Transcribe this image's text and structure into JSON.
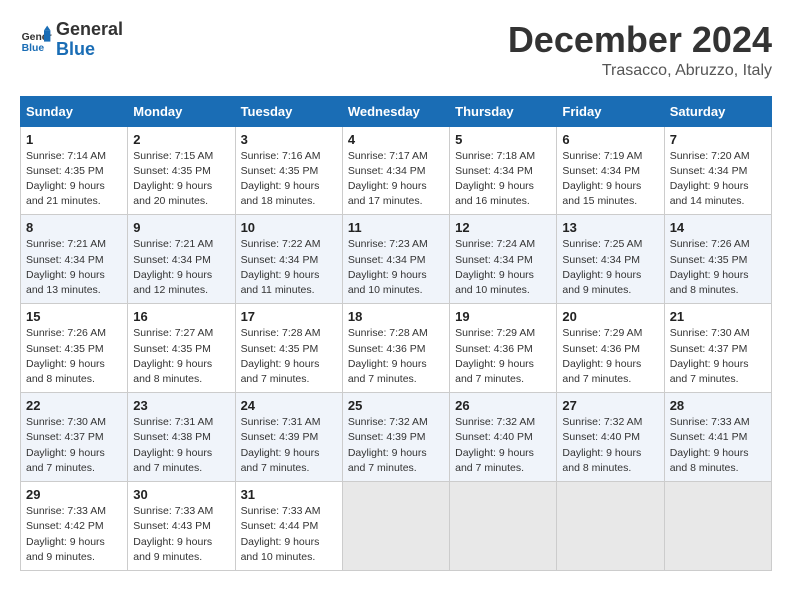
{
  "header": {
    "logo_line1": "General",
    "logo_line2": "Blue",
    "month": "December 2024",
    "location": "Trasacco, Abruzzo, Italy"
  },
  "weekdays": [
    "Sunday",
    "Monday",
    "Tuesday",
    "Wednesday",
    "Thursday",
    "Friday",
    "Saturday"
  ],
  "weeks": [
    [
      {
        "day": "1",
        "sunrise": "Sunrise: 7:14 AM",
        "sunset": "Sunset: 4:35 PM",
        "daylight": "Daylight: 9 hours and 21 minutes."
      },
      {
        "day": "2",
        "sunrise": "Sunrise: 7:15 AM",
        "sunset": "Sunset: 4:35 PM",
        "daylight": "Daylight: 9 hours and 20 minutes."
      },
      {
        "day": "3",
        "sunrise": "Sunrise: 7:16 AM",
        "sunset": "Sunset: 4:35 PM",
        "daylight": "Daylight: 9 hours and 18 minutes."
      },
      {
        "day": "4",
        "sunrise": "Sunrise: 7:17 AM",
        "sunset": "Sunset: 4:34 PM",
        "daylight": "Daylight: 9 hours and 17 minutes."
      },
      {
        "day": "5",
        "sunrise": "Sunrise: 7:18 AM",
        "sunset": "Sunset: 4:34 PM",
        "daylight": "Daylight: 9 hours and 16 minutes."
      },
      {
        "day": "6",
        "sunrise": "Sunrise: 7:19 AM",
        "sunset": "Sunset: 4:34 PM",
        "daylight": "Daylight: 9 hours and 15 minutes."
      },
      {
        "day": "7",
        "sunrise": "Sunrise: 7:20 AM",
        "sunset": "Sunset: 4:34 PM",
        "daylight": "Daylight: 9 hours and 14 minutes."
      }
    ],
    [
      {
        "day": "8",
        "sunrise": "Sunrise: 7:21 AM",
        "sunset": "Sunset: 4:34 PM",
        "daylight": "Daylight: 9 hours and 13 minutes."
      },
      {
        "day": "9",
        "sunrise": "Sunrise: 7:21 AM",
        "sunset": "Sunset: 4:34 PM",
        "daylight": "Daylight: 9 hours and 12 minutes."
      },
      {
        "day": "10",
        "sunrise": "Sunrise: 7:22 AM",
        "sunset": "Sunset: 4:34 PM",
        "daylight": "Daylight: 9 hours and 11 minutes."
      },
      {
        "day": "11",
        "sunrise": "Sunrise: 7:23 AM",
        "sunset": "Sunset: 4:34 PM",
        "daylight": "Daylight: 9 hours and 10 minutes."
      },
      {
        "day": "12",
        "sunrise": "Sunrise: 7:24 AM",
        "sunset": "Sunset: 4:34 PM",
        "daylight": "Daylight: 9 hours and 10 minutes."
      },
      {
        "day": "13",
        "sunrise": "Sunrise: 7:25 AM",
        "sunset": "Sunset: 4:34 PM",
        "daylight": "Daylight: 9 hours and 9 minutes."
      },
      {
        "day": "14",
        "sunrise": "Sunrise: 7:26 AM",
        "sunset": "Sunset: 4:35 PM",
        "daylight": "Daylight: 9 hours and 8 minutes."
      }
    ],
    [
      {
        "day": "15",
        "sunrise": "Sunrise: 7:26 AM",
        "sunset": "Sunset: 4:35 PM",
        "daylight": "Daylight: 9 hours and 8 minutes."
      },
      {
        "day": "16",
        "sunrise": "Sunrise: 7:27 AM",
        "sunset": "Sunset: 4:35 PM",
        "daylight": "Daylight: 9 hours and 8 minutes."
      },
      {
        "day": "17",
        "sunrise": "Sunrise: 7:28 AM",
        "sunset": "Sunset: 4:35 PM",
        "daylight": "Daylight: 9 hours and 7 minutes."
      },
      {
        "day": "18",
        "sunrise": "Sunrise: 7:28 AM",
        "sunset": "Sunset: 4:36 PM",
        "daylight": "Daylight: 9 hours and 7 minutes."
      },
      {
        "day": "19",
        "sunrise": "Sunrise: 7:29 AM",
        "sunset": "Sunset: 4:36 PM",
        "daylight": "Daylight: 9 hours and 7 minutes."
      },
      {
        "day": "20",
        "sunrise": "Sunrise: 7:29 AM",
        "sunset": "Sunset: 4:36 PM",
        "daylight": "Daylight: 9 hours and 7 minutes."
      },
      {
        "day": "21",
        "sunrise": "Sunrise: 7:30 AM",
        "sunset": "Sunset: 4:37 PM",
        "daylight": "Daylight: 9 hours and 7 minutes."
      }
    ],
    [
      {
        "day": "22",
        "sunrise": "Sunrise: 7:30 AM",
        "sunset": "Sunset: 4:37 PM",
        "daylight": "Daylight: 9 hours and 7 minutes."
      },
      {
        "day": "23",
        "sunrise": "Sunrise: 7:31 AM",
        "sunset": "Sunset: 4:38 PM",
        "daylight": "Daylight: 9 hours and 7 minutes."
      },
      {
        "day": "24",
        "sunrise": "Sunrise: 7:31 AM",
        "sunset": "Sunset: 4:39 PM",
        "daylight": "Daylight: 9 hours and 7 minutes."
      },
      {
        "day": "25",
        "sunrise": "Sunrise: 7:32 AM",
        "sunset": "Sunset: 4:39 PM",
        "daylight": "Daylight: 9 hours and 7 minutes."
      },
      {
        "day": "26",
        "sunrise": "Sunrise: 7:32 AM",
        "sunset": "Sunset: 4:40 PM",
        "daylight": "Daylight: 9 hours and 7 minutes."
      },
      {
        "day": "27",
        "sunrise": "Sunrise: 7:32 AM",
        "sunset": "Sunset: 4:40 PM",
        "daylight": "Daylight: 9 hours and 8 minutes."
      },
      {
        "day": "28",
        "sunrise": "Sunrise: 7:33 AM",
        "sunset": "Sunset: 4:41 PM",
        "daylight": "Daylight: 9 hours and 8 minutes."
      }
    ],
    [
      {
        "day": "29",
        "sunrise": "Sunrise: 7:33 AM",
        "sunset": "Sunset: 4:42 PM",
        "daylight": "Daylight: 9 hours and 9 minutes."
      },
      {
        "day": "30",
        "sunrise": "Sunrise: 7:33 AM",
        "sunset": "Sunset: 4:43 PM",
        "daylight": "Daylight: 9 hours and 9 minutes."
      },
      {
        "day": "31",
        "sunrise": "Sunrise: 7:33 AM",
        "sunset": "Sunset: 4:44 PM",
        "daylight": "Daylight: 9 hours and 10 minutes."
      },
      null,
      null,
      null,
      null
    ]
  ]
}
